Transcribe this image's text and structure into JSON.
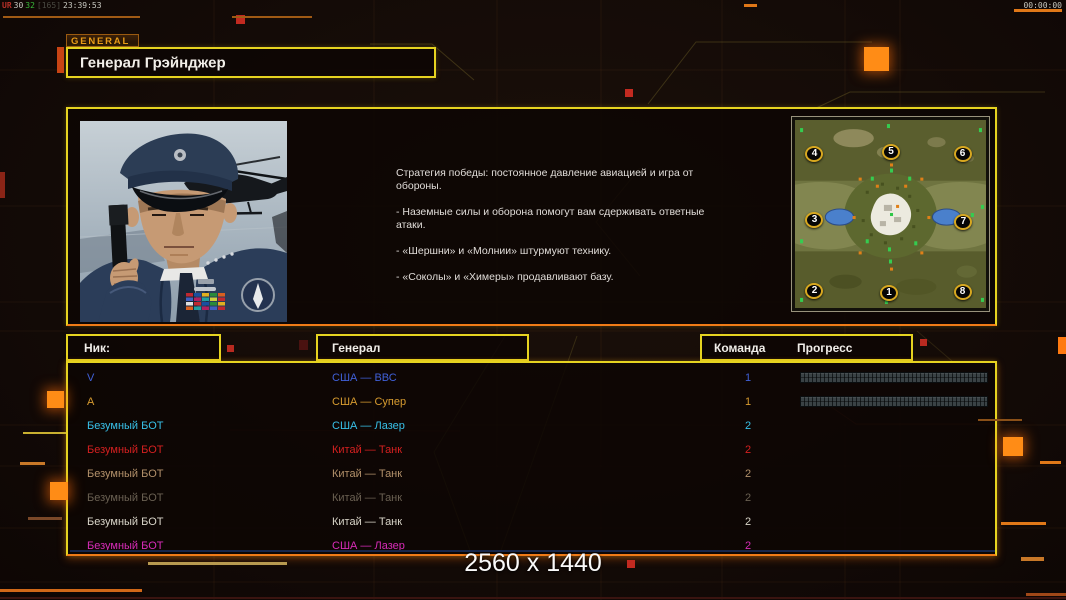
{
  "hud": {
    "debug": {
      "p1": "UR",
      "p2": "30",
      "p3": "32",
      "p4": "[165]",
      "p5": "23:39:53"
    },
    "timer": "00:00:00"
  },
  "header": {
    "tab": "GENERAL",
    "title": "Генерал Грэйнджер"
  },
  "briefing": {
    "paragraphs": [
      "Стратегия победы: постоянное давление авиацией и игра от\n обороны.",
      "- Наземные силы и оборона помогут вам сдерживать ответные\n атаки.",
      "- «Шершни» и «Молнии» штурмуют технику.",
      "- «Соколы» и «Химеры» продавливают базу."
    ]
  },
  "minimap": {
    "markers": [
      {
        "label": "4",
        "x": 10.2,
        "y": 18.0
      },
      {
        "label": "5",
        "x": 50.3,
        "y": 16.9
      },
      {
        "label": "6",
        "x": 87.7,
        "y": 18.0
      },
      {
        "label": "3",
        "x": 10.2,
        "y": 53.0
      },
      {
        "label": "7",
        "x": 88.2,
        "y": 54.1
      },
      {
        "label": "2",
        "x": 10.2,
        "y": 90.7
      },
      {
        "label": "1",
        "x": 49.2,
        "y": 91.8
      },
      {
        "label": "8",
        "x": 87.7,
        "y": 91.3
      }
    ]
  },
  "table": {
    "headers": {
      "nick": "Ник:",
      "general": "Генерал",
      "team": "Команда",
      "progress": "Прогресс"
    },
    "rows": [
      {
        "nick": "V",
        "general": "США — ВВС",
        "team": "1",
        "color": "#4060d8",
        "has_progress": true
      },
      {
        "nick": "A",
        "general": "США — Супер",
        "team": "1",
        "color": "#d89c30",
        "has_progress": true
      },
      {
        "nick": "Безумный БОТ",
        "general": "США — Лазер",
        "team": "2",
        "color": "#38c0e8",
        "has_progress": false
      },
      {
        "nick": "Безумный БОТ",
        "general": "Китай — Танк",
        "team": "2",
        "color": "#d42020",
        "has_progress": false
      },
      {
        "nick": "Безумный БОТ",
        "general": "Китай — Танк",
        "team": "2",
        "color": "#b2906a",
        "has_progress": false
      },
      {
        "nick": "Безумный БОТ",
        "general": "Китай — Танк",
        "team": "2",
        "color": "#6a6052",
        "has_progress": false
      },
      {
        "nick": "Безумный БОТ",
        "general": "Китай — Танк",
        "team": "2",
        "color": "#d8d4c8",
        "has_progress": false
      },
      {
        "nick": "Безумный БОТ",
        "general": "США — Лазер",
        "team": "2",
        "color": "#d82cb8",
        "has_progress": false
      }
    ]
  },
  "footer": {
    "resolution": "2560 x 1440"
  },
  "colors": {
    "accent_yellow": "#e6d320",
    "accent_orange": "#ef7b17"
  }
}
